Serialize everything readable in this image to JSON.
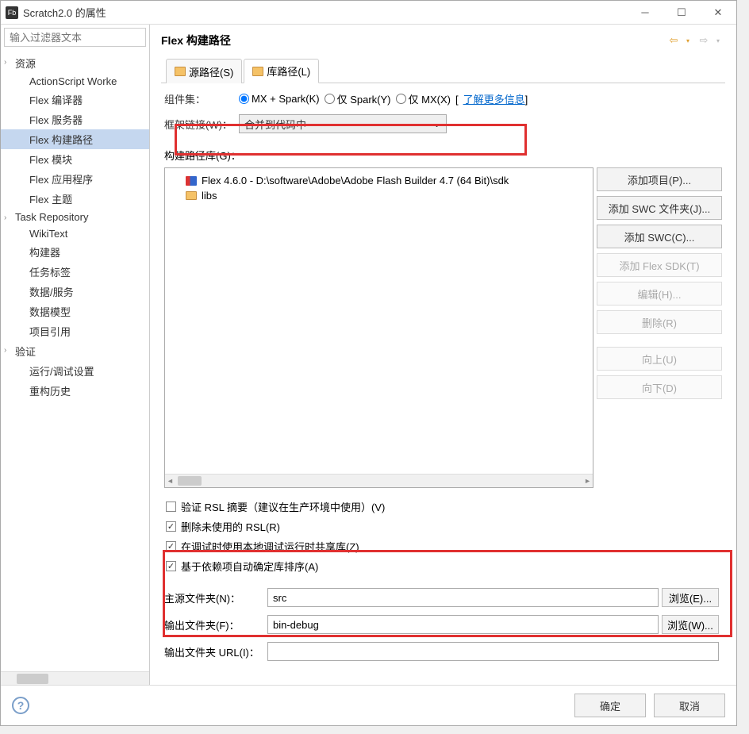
{
  "window": {
    "title": "Scratch2.0 的属性"
  },
  "sidebar": {
    "filter_placeholder": "输入过滤器文本",
    "items": [
      {
        "label": "资源",
        "expand": true,
        "child": false
      },
      {
        "label": "ActionScript Worke",
        "child": true
      },
      {
        "label": "Flex 编译器",
        "child": true
      },
      {
        "label": "Flex 服务器",
        "child": true
      },
      {
        "label": "Flex 构建路径",
        "child": true,
        "selected": true
      },
      {
        "label": "Flex 模块",
        "child": true
      },
      {
        "label": "Flex 应用程序",
        "child": true
      },
      {
        "label": "Flex 主题",
        "child": true
      },
      {
        "label": "Task Repository",
        "expand": true,
        "child": false
      },
      {
        "label": "WikiText",
        "child": true
      },
      {
        "label": "构建器",
        "child": true
      },
      {
        "label": "任务标签",
        "child": true
      },
      {
        "label": "数据/服务",
        "child": true
      },
      {
        "label": "数据模型",
        "child": true
      },
      {
        "label": "项目引用",
        "child": true
      },
      {
        "label": "验证",
        "expand": true,
        "child": false
      },
      {
        "label": "运行/调试设置",
        "child": true
      },
      {
        "label": "重构历史",
        "child": true
      }
    ]
  },
  "header": {
    "title": "Flex 构建路径"
  },
  "tabs": {
    "t0": "源路径(S)",
    "t1": "库路径(L)"
  },
  "compSet": {
    "label": "组件集：",
    "opts": {
      "o0": "MX + Spark(K)",
      "o1": "仅 Spark(Y)",
      "o2": "仅 MX(X)"
    },
    "link": "了解更多信息"
  },
  "frameLink": {
    "label": "框架链接(W)：",
    "value": "合并到代码中"
  },
  "buildPath": {
    "label": "构建路径库(G)：",
    "tree": {
      "i0": "Flex 4.6.0 - D:\\software\\Adobe\\Adobe Flash Builder 4.7 (64 Bit)\\sdk",
      "i1": "libs"
    },
    "btns": {
      "add": "添加项目(P)...",
      "addFolder": "添加 SWC 文件夹(J)...",
      "addSwc": "添加 SWC(C)...",
      "addSdk": "添加 Flex SDK(T)",
      "edit": "编辑(H)...",
      "del": "删除(R)",
      "up": "向上(U)",
      "down": "向下(D)"
    }
  },
  "chks": {
    "c0": "验证 RSL 摘要（建议在生产环境中使用）(V)",
    "c1": "删除未使用的 RSL(R)",
    "c2": "在调试时使用本地调试运行时共享库(Z)",
    "c3": "基于依赖项自动确定库排序(A)"
  },
  "folders": {
    "srcLabel": "主源文件夹(N)：",
    "src": "src",
    "outLabel": "输出文件夹(F)：",
    "out": "bin-debug",
    "urlLabel": "输出文件夹 URL(I)：",
    "url": "",
    "browseE": "浏览(E)...",
    "browseW": "浏览(W)..."
  },
  "footer": {
    "ok": "确定",
    "cancel": "取消"
  }
}
